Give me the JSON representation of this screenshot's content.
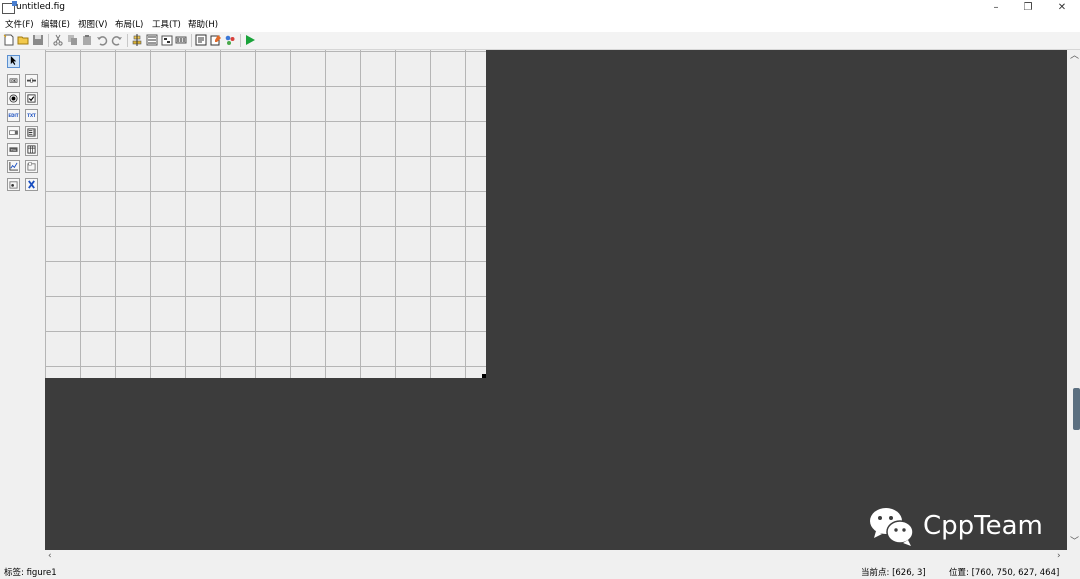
{
  "window": {
    "title": "untitled.fig",
    "controls": {
      "minimize": "–",
      "restore": "❐",
      "close": "✕"
    }
  },
  "menu": [
    "文件(F)",
    "编辑(E)",
    "视图(V)",
    "布局(L)",
    "工具(T)",
    "帮助(H)"
  ],
  "toolbar_icons": [
    "new-file-icon",
    "open-file-icon",
    "save-icon",
    "cut-icon",
    "copy-icon",
    "paste-icon",
    "undo-icon",
    "redo-icon",
    "align-icon",
    "menu-editor-icon",
    "tab-order-icon",
    "toolbar-editor-icon",
    "editor-icon",
    "property-inspector-icon",
    "object-browser-icon",
    "run-icon"
  ],
  "palette": {
    "tools": [
      "select-tool",
      "push-button-tool",
      "slider-tool",
      "radio-button-tool",
      "checkbox-tool",
      "edit-text-tool",
      "static-text-tool",
      "popup-menu-tool",
      "listbox-tool",
      "toggle-button-tool",
      "table-tool",
      "axes-tool",
      "panel-tool",
      "button-group-tool",
      "activex-tool"
    ],
    "edit_label": "EDIT",
    "text_label": "TXT"
  },
  "status": {
    "tag": "标签: figure1",
    "current_point": "当前点:  [626, 3]",
    "position": "位置: [760, 750, 627, 464]"
  },
  "watermark": {
    "text": "CppTeam"
  },
  "colors": {
    "canvas": "#3c3c3c",
    "grid_bg": "#efefef",
    "run": "#1aa33a"
  }
}
